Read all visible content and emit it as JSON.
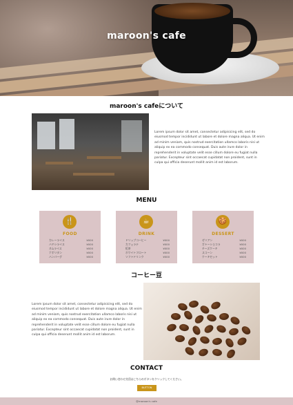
{
  "hero": {
    "title": "maroon's cafe"
  },
  "about": {
    "title": "maroon's cafeについて",
    "text": "Lorem ipsum dolor sit amet, consectetur adipisicing elit, sed do eiusmod tempor incididunt ut labore et dolore magna aliqua. Ut enim ad minim veniam, quis nostrud exercitation ullamco laboris nisi ut aliquip ex ea commodo consequat. Duis aute irure dolor in reprehenderit in voluptate velit esse cillum dolore eu fugiat nulla pariatur. Excepteur sint occaecat cupidatat non proident, sunt in culpa qui officia deserunt mollit anim id est laborum."
  },
  "menu": {
    "title": "MENU",
    "cards": [
      {
        "icon": "food-icon",
        "glyph": "🍴",
        "heading": "FOOD",
        "items": [
          {
            "name": "カレーライス",
            "price": "¥000"
          },
          {
            "name": "ハヤシライス",
            "price": "¥000"
          },
          {
            "name": "オムライス",
            "price": "¥000"
          },
          {
            "name": "ナポリタン",
            "price": "¥000"
          },
          {
            "name": "ハンバーグ",
            "price": "¥000"
          }
        ]
      },
      {
        "icon": "drink-icon",
        "glyph": "☕",
        "heading": "DRINK",
        "items": [
          {
            "name": "ドリップコーヒー",
            "price": "¥000"
          },
          {
            "name": "カフェラテ",
            "price": "¥000"
          },
          {
            "name": "紅茶",
            "price": "¥000"
          },
          {
            "name": "ホワイトフロート",
            "price": "¥000"
          },
          {
            "name": "ソフトドリンク",
            "price": "¥000"
          }
        ]
      },
      {
        "icon": "dessert-icon",
        "glyph": "🍪",
        "heading": "DESSERT",
        "items": [
          {
            "name": "ゼリアン",
            "price": "¥000"
          },
          {
            "name": "ガトーショコラ",
            "price": "¥000"
          },
          {
            "name": "チーズケーキ",
            "price": "¥000"
          },
          {
            "name": "スコーン",
            "price": "¥000"
          },
          {
            "name": "ケーキセット",
            "price": "¥000"
          }
        ]
      }
    ]
  },
  "beans": {
    "title": "コーヒー豆",
    "text": "Lorem ipsum dolor sit amet, consectetur adipisicing elit, sed do eiusmod tempor incididunt ut labore et dolore magna aliqua. Ut enim ad minim veniam, quis nostrud exercitation ullamco laboris nisi ut aliquip ex ea commodo consequat. Duis aute irure dolor in reprehenderit in voluptate velit esse cillum dolore eu fugiat nulla pariatur. Excepteur sint occaecat cupidatat non proident, sunt in culpa qui officia deserunt mollit anim id est laborum."
  },
  "contact": {
    "title": "CONTACT",
    "note": "お問い合わせ先用はこちらのボタンをクリックしてください。",
    "button": "BUTTON"
  },
  "footer": {
    "text": "@maroon's cafe"
  },
  "colors": {
    "accent": "#c9951a",
    "card": "#dbc5c7"
  }
}
